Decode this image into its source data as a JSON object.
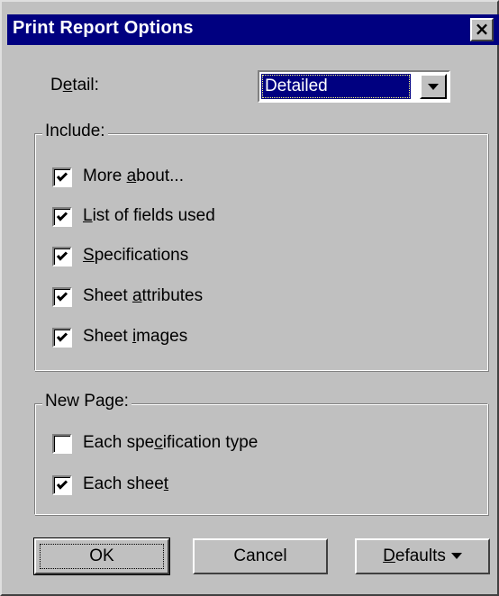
{
  "dialog": {
    "title": "Print Report Options",
    "close_label": "×"
  },
  "detail": {
    "label_pre": "D",
    "label_mnemonic": "e",
    "label_post": "tail:",
    "selected_value": "Detailed",
    "arrow_icon": "chevron-down-icon"
  },
  "include": {
    "legend": "Include:",
    "items": [
      {
        "pre": "More ",
        "mnemonic": "a",
        "post": "bout...",
        "checked": true
      },
      {
        "pre": "",
        "mnemonic": "L",
        "post": "ist of fields used",
        "checked": true
      },
      {
        "pre": "",
        "mnemonic": "S",
        "post": "pecifications",
        "checked": true
      },
      {
        "pre": "Sheet ",
        "mnemonic": "a",
        "post": "ttributes",
        "checked": true
      },
      {
        "pre": "Sheet ",
        "mnemonic": "i",
        "post": "mages",
        "checked": true
      }
    ]
  },
  "new_page": {
    "legend": "New Page:",
    "items": [
      {
        "pre": "Each spe",
        "mnemonic": "c",
        "post": "ification type",
        "checked": false
      },
      {
        "pre": "Each shee",
        "mnemonic": "t",
        "post": "",
        "checked": true
      }
    ]
  },
  "buttons": {
    "ok": "OK",
    "cancel": "Cancel",
    "defaults_mnemonic": "D",
    "defaults_post": "efaults"
  }
}
